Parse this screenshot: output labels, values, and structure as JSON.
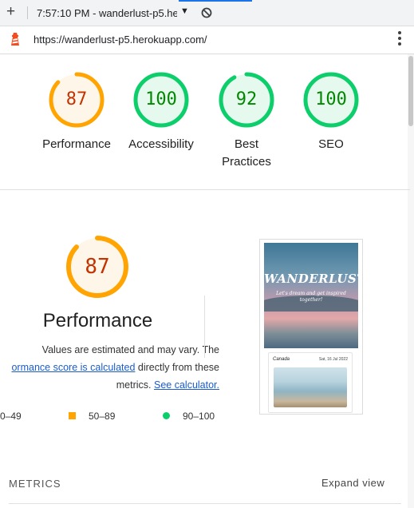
{
  "browser": {
    "tab_title": "7:57:10 PM - wanderlust-p5.he",
    "new_tab_icon": "plus-icon",
    "dropdown_icon": "caret-down-icon",
    "block_icon": "block-icon",
    "url": "https://wanderlust-p5.herokuapp.com/",
    "site_icon": "lighthouse-icon",
    "menu_icon": "kebab-menu-icon"
  },
  "scores": [
    {
      "label": "Performance",
      "value": "87",
      "score": 87,
      "status": "average"
    },
    {
      "label": "Accessibility",
      "value": "100",
      "score": 100,
      "status": "pass"
    },
    {
      "label": "Best Practices",
      "value": "92",
      "score": 92,
      "status": "pass"
    },
    {
      "label": "SEO",
      "value": "100",
      "score": 100,
      "status": "pass"
    }
  ],
  "performance": {
    "value": "87",
    "score": 87,
    "title": "Performance",
    "desc_line1": "Values are estimated and may vary. The",
    "desc_link1": "ormance score is calculated",
    "desc_line2_rest": " directly from these",
    "desc_line3_pre": "metrics. ",
    "desc_link2": "See calculator."
  },
  "legend": {
    "fail": "0–49",
    "average": "50–89",
    "pass": "90–100"
  },
  "screenshot": {
    "hero_title": "WANDERLUST",
    "hero_subtitle": "Let's dream and get inspired together!",
    "card_place": "Canada",
    "card_date": "Sat, 16 Jul 2022"
  },
  "metrics": {
    "label": "METRICS",
    "expand": "Expand view"
  },
  "colors": {
    "pass": "#0cce6b",
    "pass_text": "#008800",
    "pass_bg": "#e6f9ee",
    "average": "#ffa400",
    "average_text": "#c33300",
    "average_bg": "#fff6ea",
    "link": "#1a5ccf"
  }
}
